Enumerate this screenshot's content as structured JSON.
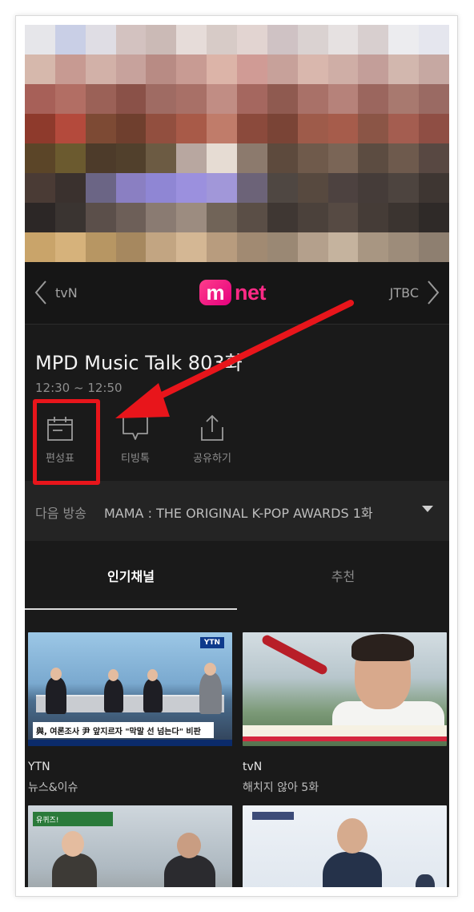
{
  "channel_bar": {
    "prev_channel": "tvN",
    "next_channel": "JTBC",
    "logo_text": "net",
    "logo_letter": "m"
  },
  "program": {
    "title": "MPD Music Talk 803화",
    "time": "12:30 ~ 12:50",
    "actions": [
      {
        "label": "편성표",
        "icon": "schedule-icon"
      },
      {
        "label": "티빙톡",
        "icon": "chat-icon"
      },
      {
        "label": "공유하기",
        "icon": "share-icon"
      }
    ]
  },
  "next_broadcast": {
    "label": "다음 방송",
    "title": "MAMA : THE ORIGINAL K-POP AWARDS 1화"
  },
  "tabs": [
    {
      "label": "인기채널",
      "active": true
    },
    {
      "label": "추천",
      "active": false
    }
  ],
  "cards": [
    {
      "channel": "YTN",
      "program": "뉴스&이슈",
      "caption": "與, 여론조사 尹 앞지르자 \"막말 선 넘는다\" 비판",
      "badge": "YTN"
    },
    {
      "channel": "tvN",
      "program": "해치지 않아 5화"
    },
    {
      "channel": "",
      "program": "",
      "badge": "유퀴즈!"
    },
    {
      "channel": "",
      "program": ""
    }
  ],
  "colors": {
    "accent_highlight": "#e8151b",
    "brand_mnet": "#ff2a86",
    "background": "#1a1a1a"
  }
}
